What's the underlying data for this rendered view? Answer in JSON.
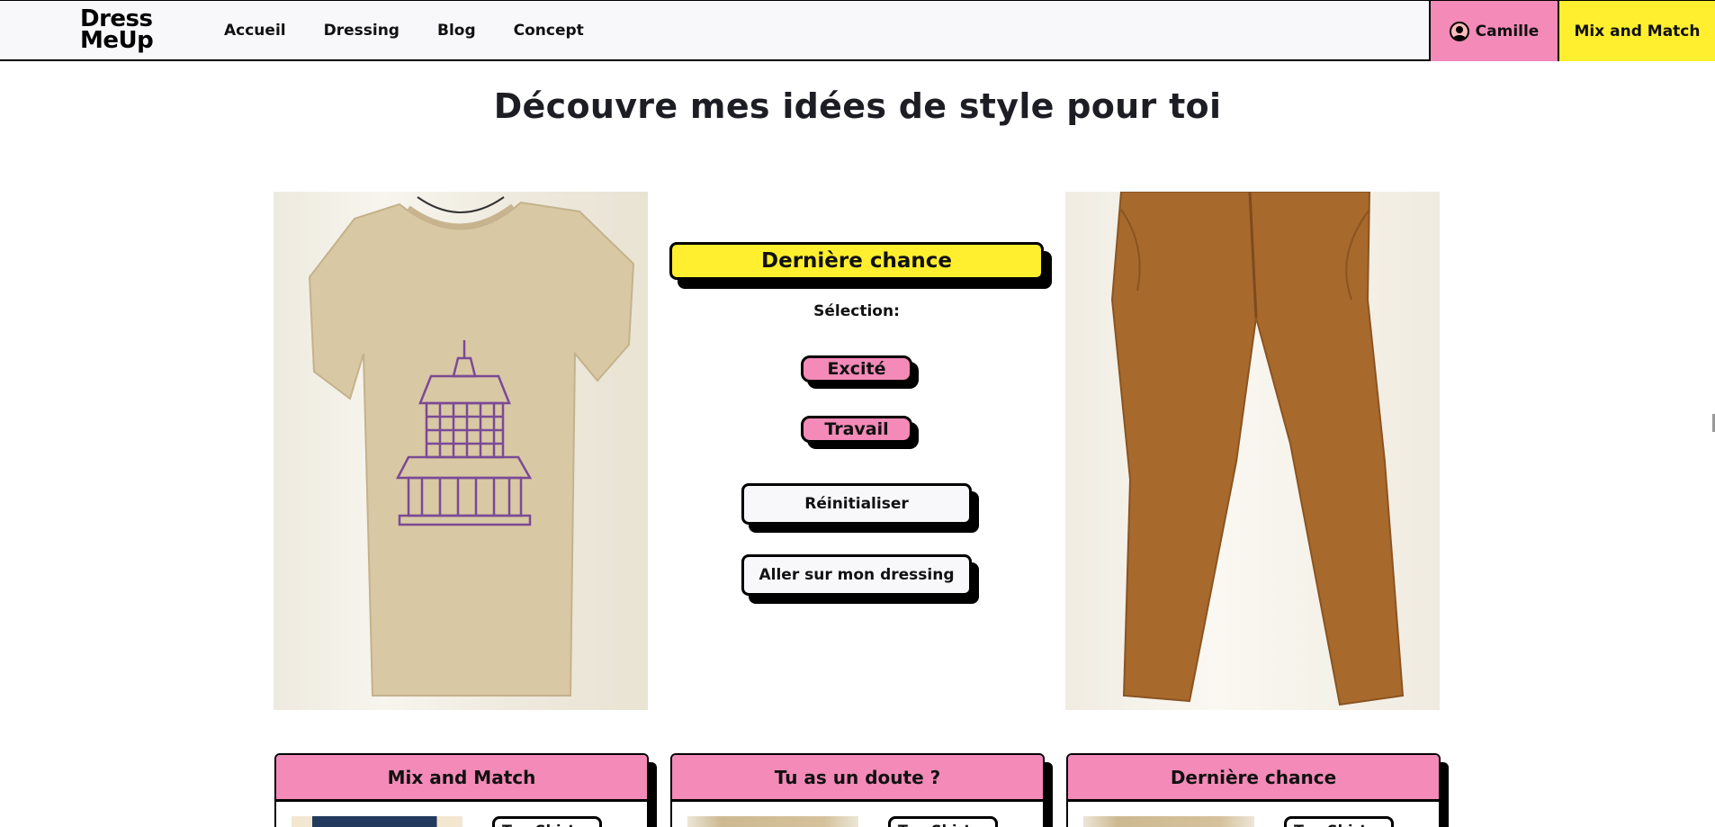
{
  "header": {
    "logo_line1": "Dress",
    "logo_line2": "MeUp",
    "nav": [
      "Accueil",
      "Dressing",
      "Blog",
      "Concept"
    ],
    "user_label": "Camille",
    "mix_label": "Mix and Match"
  },
  "page_title": "Découvre mes idées de style pour toi",
  "panel": {
    "chance_label": "Dernière chance",
    "selection_label": "Sélection:",
    "tags": [
      "Excité",
      "Travail"
    ],
    "reset_label": "Réinitialiser",
    "dressing_label": "Aller sur mon dressing"
  },
  "cards": [
    {
      "title": "Mix and Match",
      "chip": "Tee-Shirt"
    },
    {
      "title": "Tu as un doute ?",
      "chip": "Tee-Shirt"
    },
    {
      "title": "Dernière chance",
      "chip": "Tee-Shirt"
    }
  ],
  "colors": {
    "pink": "#f38ab8",
    "yellow": "#ffef2e",
    "tshirt": "#d9c8a4",
    "print": "#7a4a96",
    "pants": "#a8692c"
  },
  "icons": {
    "user": "user-icon"
  }
}
